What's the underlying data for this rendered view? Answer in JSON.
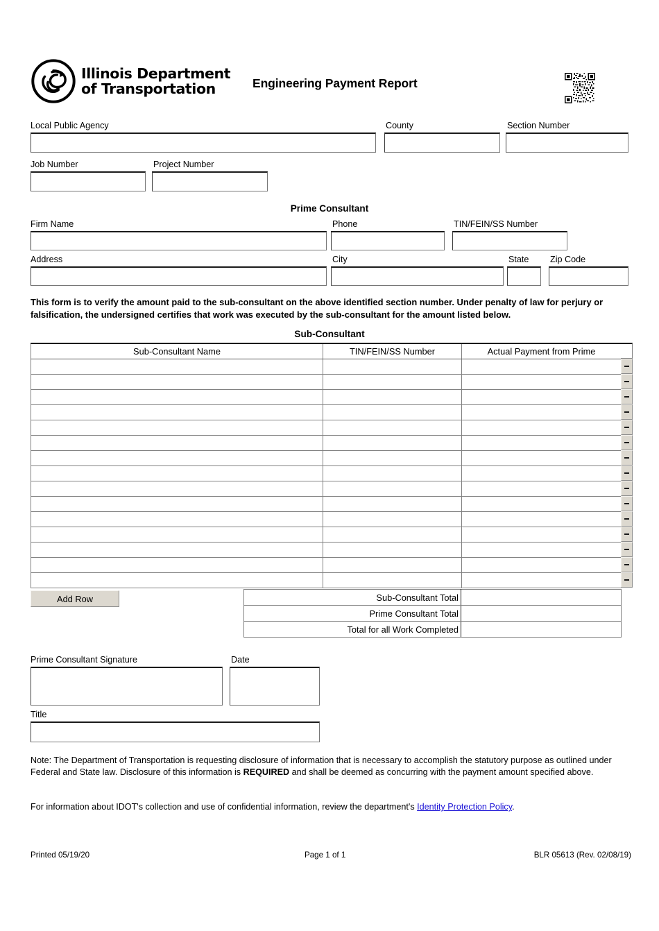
{
  "agency": {
    "name_line1": "Illinois Department",
    "name_line2": "of Transportation",
    "logo_icon": "idot-triskelion-logo",
    "qr_icon": "qr-code"
  },
  "header": {
    "title": "Engineering Payment Report"
  },
  "project_info": {
    "local_public_agency": {
      "label": "Local Public Agency",
      "value": ""
    },
    "county": {
      "label": "County",
      "value": ""
    },
    "section_number": {
      "label": "Section Number",
      "value": ""
    },
    "job_number": {
      "label": "Job Number",
      "value": ""
    },
    "project_number": {
      "label": "Project Number",
      "value": ""
    }
  },
  "prime_consultant": {
    "heading": "Prime Consultant",
    "firm_name": {
      "label": "Firm Name",
      "value": ""
    },
    "phone": {
      "label": "Phone",
      "value": ""
    },
    "tin": {
      "label": "TIN/FEIN/SS Number",
      "value": ""
    },
    "address": {
      "label": "Address",
      "value": ""
    },
    "city": {
      "label": "City",
      "value": ""
    },
    "state": {
      "label": "State",
      "value": ""
    },
    "zip_code": {
      "label": "Zip Code",
      "value": ""
    }
  },
  "certification": {
    "text": "This form is to verify the amount paid to the sub-consultant on the above identified section number.  Under penalty of law for perjury or falsification, the undersigned certifies that work was executed by the sub-consultant for the amount listed below."
  },
  "sub_consultant": {
    "heading": "Sub-Consultant",
    "columns": [
      "Sub-Consultant Name",
      "TIN/FEIN/SS Number",
      "Actual Payment from Prime"
    ],
    "row_count": 15,
    "rows": [
      {
        "name": "",
        "tin": "",
        "payment": ""
      },
      {
        "name": "",
        "tin": "",
        "payment": ""
      },
      {
        "name": "",
        "tin": "",
        "payment": ""
      },
      {
        "name": "",
        "tin": "",
        "payment": ""
      },
      {
        "name": "",
        "tin": "",
        "payment": ""
      },
      {
        "name": "",
        "tin": "",
        "payment": ""
      },
      {
        "name": "",
        "tin": "",
        "payment": ""
      },
      {
        "name": "",
        "tin": "",
        "payment": ""
      },
      {
        "name": "",
        "tin": "",
        "payment": ""
      },
      {
        "name": "",
        "tin": "",
        "payment": ""
      },
      {
        "name": "",
        "tin": "",
        "payment": ""
      },
      {
        "name": "",
        "tin": "",
        "payment": ""
      },
      {
        "name": "",
        "tin": "",
        "payment": ""
      },
      {
        "name": "",
        "tin": "",
        "payment": ""
      },
      {
        "name": "",
        "tin": "",
        "payment": ""
      }
    ],
    "delete_row_icon": "minus-icon",
    "add_row_label": "Add Row"
  },
  "totals": {
    "rows": [
      {
        "label": "Sub-Consultant Total",
        "value": ""
      },
      {
        "label": "Prime Consultant Total",
        "value": ""
      },
      {
        "label": "Total for all Work Completed",
        "value": ""
      }
    ]
  },
  "signature": {
    "prime_signature": {
      "label": "Prime Consultant Signature",
      "value": ""
    },
    "date": {
      "label": "Date",
      "value": ""
    },
    "title": {
      "label": "Title",
      "value": ""
    }
  },
  "note": {
    "part1": "Note: The Department of Transportation is requesting disclosure of information that is necessary to accomplish the statutory purpose as outlined under Federal and State law. Disclosure of this information is ",
    "required_word": "REQUIRED",
    "part2": " and shall be deemed as concurring with the payment amount specified above.",
    "privacy_prefix": "For information about IDOT's collection and use of confidential information, review the department's ",
    "privacy_link": "Identity Protection Policy",
    "privacy_suffix": "."
  },
  "footer": {
    "printed": "Printed 05/19/20",
    "page": "Page 1 of 1",
    "form_id": "BLR 05613 (Rev. 02/08/19)"
  },
  "colors": {
    "link": "#1a12d6",
    "button_face": "#dcd8cf",
    "border": "#808080"
  }
}
